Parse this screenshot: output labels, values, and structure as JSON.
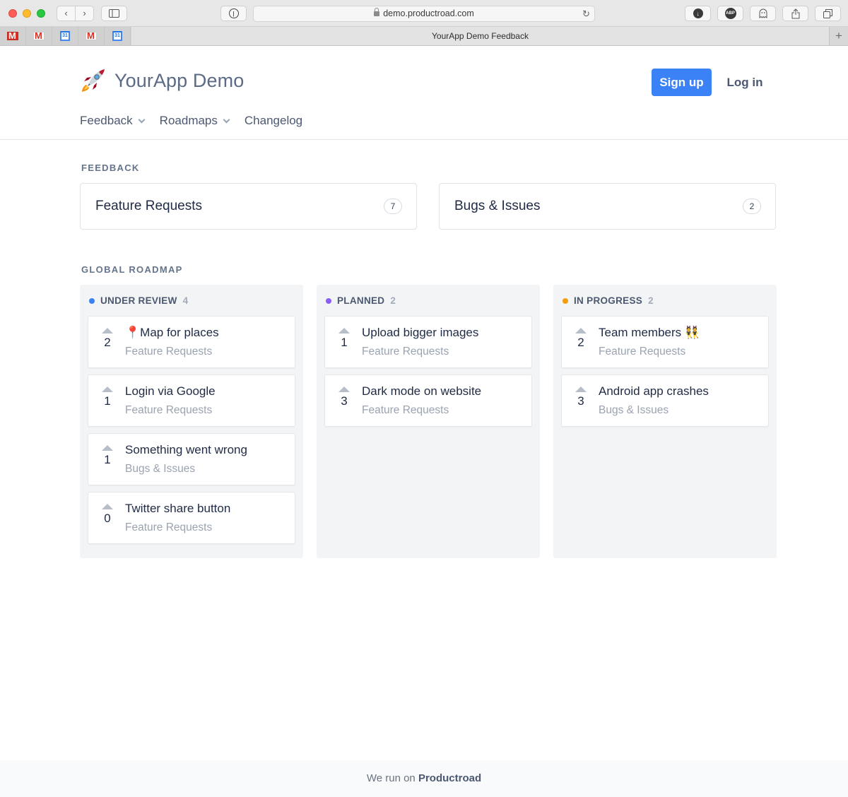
{
  "browser": {
    "url": "demo.productroad.com",
    "tab_title": "YourApp Demo Feedback",
    "pinned_tabs": [
      {
        "icon": "gmail-icon"
      },
      {
        "icon": "gmail-icon"
      },
      {
        "icon": "google-calendar-icon",
        "text": "31"
      },
      {
        "icon": "gmail-icon"
      },
      {
        "icon": "google-calendar-icon",
        "text": "31"
      }
    ],
    "extensions": {
      "adblock_label": "ABP"
    }
  },
  "header": {
    "app_name": "YourApp Demo",
    "signup_label": "Sign up",
    "login_label": "Log in",
    "accent": "#3b82f6",
    "nav": [
      {
        "label": "Feedback",
        "dropdown": true
      },
      {
        "label": "Roadmaps",
        "dropdown": true
      },
      {
        "label": "Changelog",
        "dropdown": false
      }
    ]
  },
  "feedback": {
    "title": "FEEDBACK",
    "boards": [
      {
        "name": "Feature Requests",
        "count": "7"
      },
      {
        "name": "Bugs & Issues",
        "count": "2"
      }
    ]
  },
  "roadmap": {
    "title": "GLOBAL ROADMAP",
    "columns": [
      {
        "name": "UNDER REVIEW",
        "count": "4",
        "color": "#3b82f6",
        "posts": [
          {
            "title": "📍Map for places",
            "board": "Feature Requests",
            "votes": "2"
          },
          {
            "title": "Login via Google",
            "board": "Feature Requests",
            "votes": "1"
          },
          {
            "title": "Something went wrong",
            "board": "Bugs & Issues",
            "votes": "1"
          },
          {
            "title": "Twitter share button",
            "board": "Feature Requests",
            "votes": "0"
          }
        ]
      },
      {
        "name": "PLANNED",
        "count": "2",
        "color": "#8b5cf6",
        "posts": [
          {
            "title": "Upload bigger images",
            "board": "Feature Requests",
            "votes": "1"
          },
          {
            "title": "Dark mode on website",
            "board": "Feature Requests",
            "votes": "3"
          }
        ]
      },
      {
        "name": "IN PROGRESS",
        "count": "2",
        "color": "#f59e0b",
        "posts": [
          {
            "title": "Team members 👯",
            "board": "Feature Requests",
            "votes": "2"
          },
          {
            "title": "Android app crashes",
            "board": "Bugs & Issues",
            "votes": "3"
          }
        ]
      }
    ]
  },
  "footer": {
    "prefix": "We run on",
    "brand": "Productroad"
  }
}
